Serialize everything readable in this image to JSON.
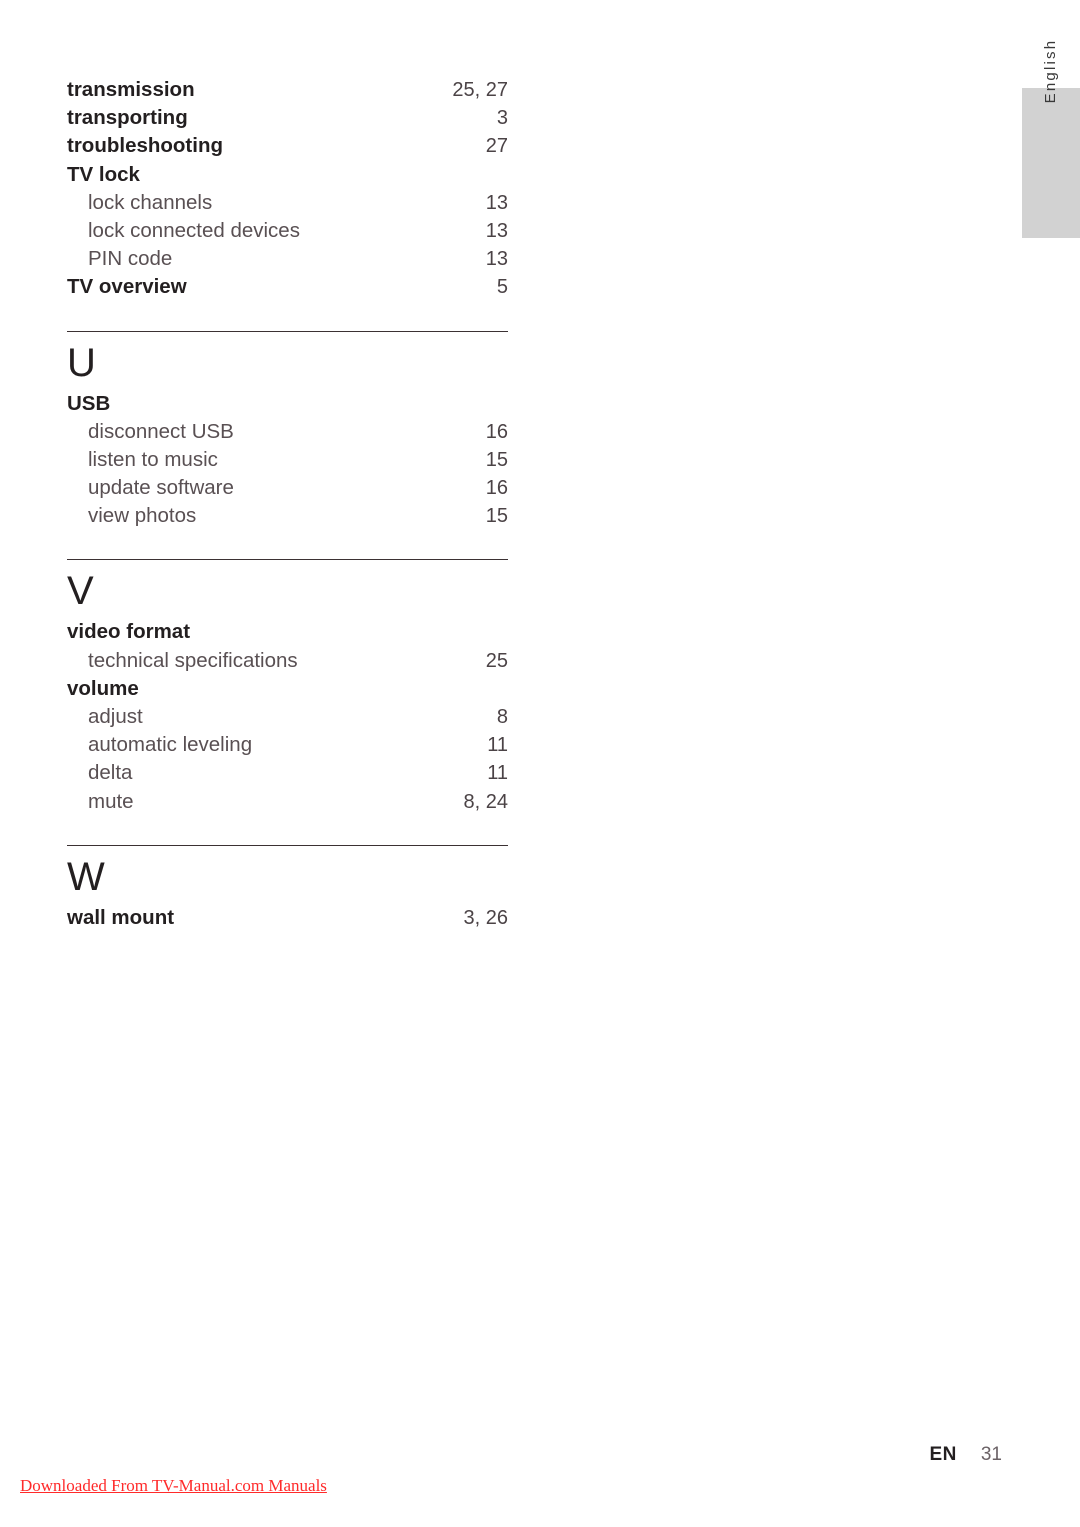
{
  "language_tab": {
    "label": "English"
  },
  "index": {
    "top_entries": [
      {
        "term": "transmission",
        "page": "25, 27",
        "level": "main"
      },
      {
        "term": "transporting",
        "page": "3",
        "level": "main"
      },
      {
        "term": "troubleshooting",
        "page": "27",
        "level": "main"
      },
      {
        "term": "TV lock",
        "page": "",
        "level": "main"
      },
      {
        "term": "lock channels",
        "page": "13",
        "level": "sub"
      },
      {
        "term": "lock connected devices",
        "page": "13",
        "level": "sub"
      },
      {
        "term": "PIN code",
        "page": "13",
        "level": "sub"
      },
      {
        "term": "TV overview",
        "page": "5",
        "level": "main"
      }
    ],
    "groups": [
      {
        "letter": "U",
        "entries": [
          {
            "term": "USB",
            "page": "",
            "level": "main"
          },
          {
            "term": "disconnect USB",
            "page": "16",
            "level": "sub"
          },
          {
            "term": "listen to music",
            "page": "15",
            "level": "sub"
          },
          {
            "term": "update software",
            "page": "16",
            "level": "sub"
          },
          {
            "term": "view photos",
            "page": "15",
            "level": "sub"
          }
        ]
      },
      {
        "letter": "V",
        "entries": [
          {
            "term": "video format",
            "page": "",
            "level": "main"
          },
          {
            "term": "technical specifications",
            "page": "25",
            "level": "sub"
          },
          {
            "term": "volume",
            "page": "",
            "level": "main"
          },
          {
            "term": "adjust",
            "page": "8",
            "level": "sub"
          },
          {
            "term": "automatic leveling",
            "page": "11",
            "level": "sub"
          },
          {
            "term": "delta",
            "page": "11",
            "level": "sub"
          },
          {
            "term": "mute",
            "page": "8, 24",
            "level": "sub"
          }
        ]
      },
      {
        "letter": "W",
        "entries": [
          {
            "term": "wall mount",
            "page": "3, 26",
            "level": "main"
          }
        ]
      }
    ]
  },
  "footer": {
    "language_code": "EN",
    "page_number": "31",
    "download_link": "Downloaded From TV-Manual.com Manuals"
  },
  "colors": {
    "tab_background": "#d2d2d2",
    "main_text": "#231f20",
    "sub_text": "#595053",
    "rule": "#3b3133",
    "link_red": "#ff2a2a"
  }
}
